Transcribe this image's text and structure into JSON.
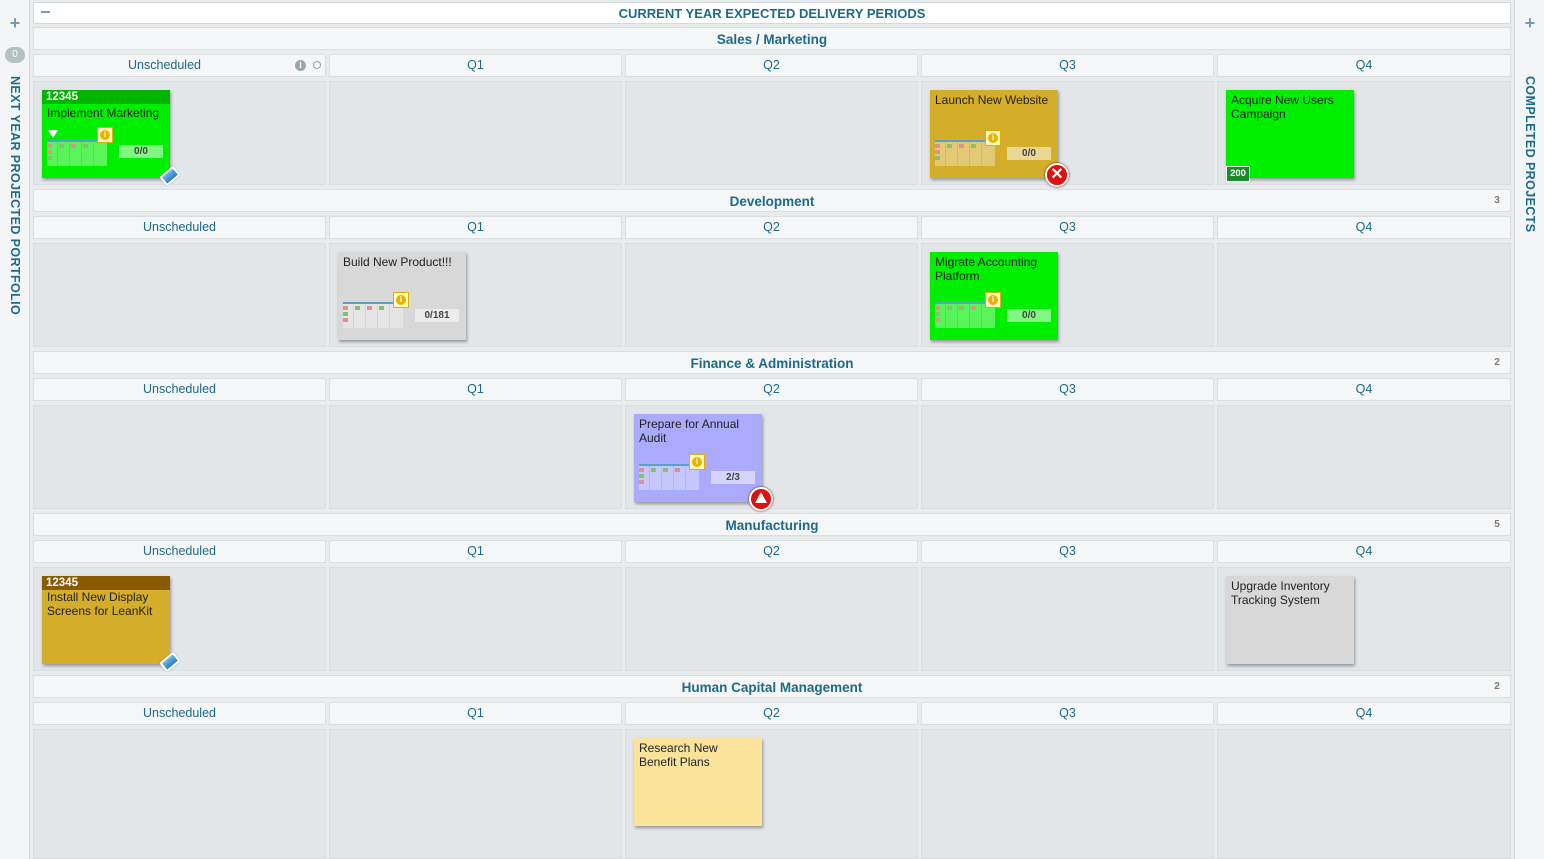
{
  "left_panel": {
    "title": "NEXT YEAR PROJECTED PORTFOLIO",
    "count": "0",
    "add_icon": "plus-icon"
  },
  "right_panel": {
    "title": "COMPLETED PROJECTS",
    "add_icon": "plus-icon"
  },
  "board": {
    "title": "CURRENT YEAR EXPECTED DELIVERY PERIODS",
    "collapse_icon": "minus-icon"
  },
  "columns": [
    "Unscheduled",
    "Q1",
    "Q2",
    "Q3",
    "Q4"
  ],
  "sections": [
    {
      "title": "Sales / Marketing",
      "count": ""
    },
    {
      "title": "Development",
      "count": "3"
    },
    {
      "title": "Finance & Administration",
      "count": "2"
    },
    {
      "title": "Manufacturing",
      "count": "5"
    },
    {
      "title": "Human Capital Management",
      "count": "2"
    }
  ],
  "cards": {
    "c1": {
      "id": "12345",
      "title": "Implement Marketing",
      "progress": "0/0",
      "color": "#00ee00",
      "id_color": "#00b400"
    },
    "c2": {
      "title": "Launch New Website",
      "progress": "0/0",
      "color": "#d4ad2a"
    },
    "c3": {
      "title": "Acquire New Users Campaign",
      "size": "200",
      "color": "#00ee00"
    },
    "c4": {
      "title": "Build New Product!!!",
      "progress": "0/181",
      "color": "#d8d8d8"
    },
    "c5": {
      "title": "Migrate Accounting Platform",
      "progress": "0/0",
      "color": "#00ee00"
    },
    "c6": {
      "title": "Prepare for Annual Audit",
      "progress": "2/3",
      "color": "#aaaaff"
    },
    "c7": {
      "id": "12345",
      "title": "Install New Display Screens for LeanKit",
      "color": "#d4ad2a",
      "id_color": "#8a5a00"
    },
    "c8": {
      "title": "Upgrade Inventory Tracking System",
      "color": "#d8d8d8"
    },
    "c9": {
      "title": "Research New Benefit Plans",
      "color": "#fbe39c"
    }
  }
}
